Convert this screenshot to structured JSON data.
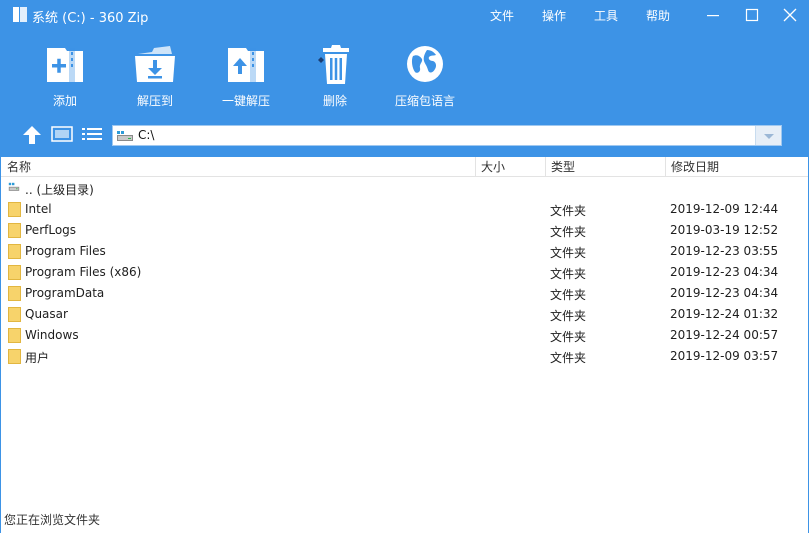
{
  "window": {
    "title": "系统 (C:) - 360 Zip"
  },
  "menu": {
    "file": "文件",
    "ops": "操作",
    "tools": "工具",
    "help": "帮助"
  },
  "toolbar": {
    "add": "添加",
    "extract_to": "解压到",
    "one_click_extract": "一键解压",
    "delete": "删除",
    "language": "压缩包语言"
  },
  "address": {
    "path": "C:\\"
  },
  "columns": {
    "name": "名称",
    "size": "大小",
    "type": "类型",
    "date": "修改日期"
  },
  "parent_entry": ".. (上级目录)",
  "files": [
    {
      "name": "Intel",
      "type": "文件夹",
      "date": "2019-12-09 12:44"
    },
    {
      "name": "PerfLogs",
      "type": "文件夹",
      "date": "2019-03-19 12:52"
    },
    {
      "name": "Program Files",
      "type": "文件夹",
      "date": "2019-12-23 03:55"
    },
    {
      "name": "Program Files (x86)",
      "type": "文件夹",
      "date": "2019-12-23 04:34"
    },
    {
      "name": "ProgramData",
      "type": "文件夹",
      "date": "2019-12-23 04:34"
    },
    {
      "name": "Quasar",
      "type": "文件夹",
      "date": "2019-12-24 01:32"
    },
    {
      "name": "Windows",
      "type": "文件夹",
      "date": "2019-12-24 00:57"
    },
    {
      "name": "用户",
      "type": "文件夹",
      "date": "2019-12-09 03:57"
    }
  ],
  "status": {
    "text": "您正在浏览文件夹"
  },
  "colors": {
    "accent": "#3d93e6",
    "folder": "#f7d36b",
    "folder_edge": "#e2b640"
  }
}
